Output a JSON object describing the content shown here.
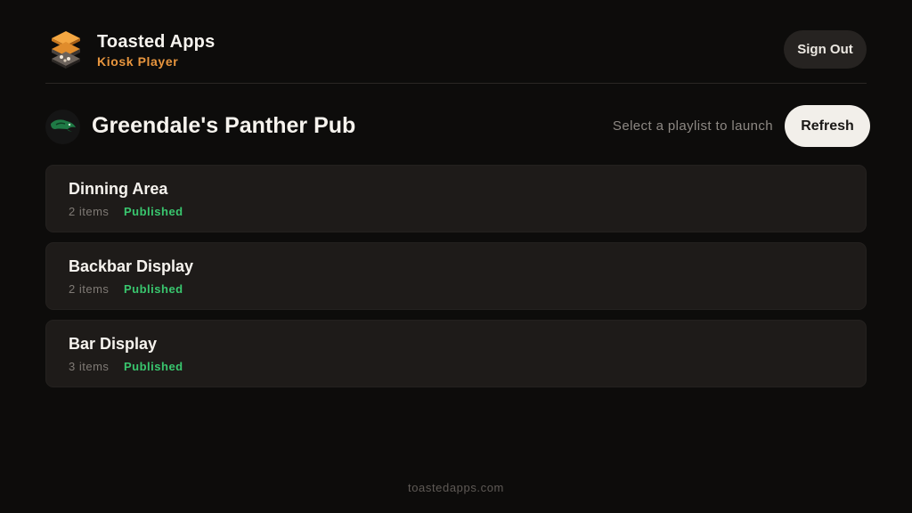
{
  "header": {
    "app_name": "Toasted Apps",
    "app_subtitle": "Kiosk Player",
    "logo_icon": "toast-stack-logo-icon",
    "sign_out_label": "Sign Out"
  },
  "venue": {
    "name": "Greendale's Panther Pub",
    "avatar_icon": "panther-logo-icon",
    "hint": "Select a playlist to launch",
    "refresh_label": "Refresh"
  },
  "playlists": [
    {
      "title": "Dinning Area",
      "count": "2 items",
      "status": "Published"
    },
    {
      "title": "Backbar Display",
      "count": "2 items",
      "status": "Published"
    },
    {
      "title": "Bar Display",
      "count": "3 items",
      "status": "Published"
    }
  ],
  "footer": {
    "text": "toastedapps.com"
  },
  "colors": {
    "background": "#0d0c0b",
    "card": "#1e1b19",
    "accent_orange": "#e9963e",
    "status_green": "#39c66e",
    "refresh_button": "#f2efea"
  }
}
